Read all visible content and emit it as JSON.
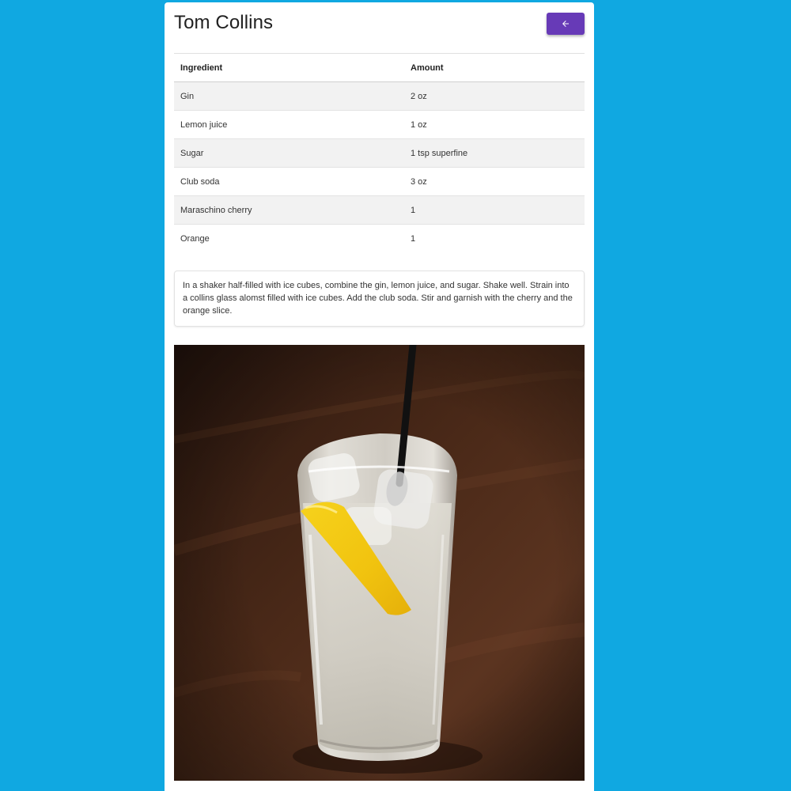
{
  "drink": {
    "title": "Tom Collins",
    "back_icon": "arrow-left-icon",
    "accent_color": "#673ab7",
    "page_background": "#10a8e1"
  },
  "table": {
    "headers": {
      "ingredient": "Ingredient",
      "amount": "Amount"
    },
    "rows": [
      {
        "ingredient": "Gin",
        "amount": "2 oz"
      },
      {
        "ingredient": "Lemon juice",
        "amount": "1 oz"
      },
      {
        "ingredient": "Sugar",
        "amount": "1 tsp superfine"
      },
      {
        "ingredient": "Club soda",
        "amount": "3 oz"
      },
      {
        "ingredient": "Maraschino cherry",
        "amount": "1"
      },
      {
        "ingredient": "Orange",
        "amount": "1"
      }
    ]
  },
  "instructions": "In a shaker half-filled with ice cubes, combine the gin, lemon juice, and sugar. Shake well. Strain into a collins glass alomst filled with ice cubes. Add the club soda. Stir and garnish with the cherry and the orange slice."
}
